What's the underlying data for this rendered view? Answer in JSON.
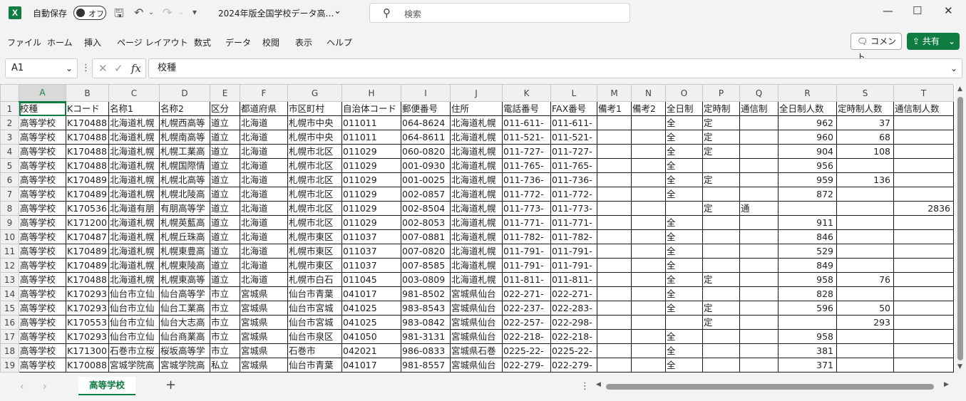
{
  "titlebar": {
    "autosave_label": "自動保存",
    "autosave_state": "オフ",
    "doc_title": "2024年版全国学校データ高…",
    "search_placeholder": "検索"
  },
  "menu": [
    "ファイル",
    "ホーム",
    "挿入",
    "ページ レイアウト",
    "数式",
    "データ",
    "校閲",
    "表示",
    "ヘルプ"
  ],
  "ribbon_buttons": {
    "comment": "コメント",
    "share": "共有"
  },
  "formula_bar": {
    "cell_ref": "A1",
    "value": "校種",
    "fx": "fx"
  },
  "columns": [
    "A",
    "B",
    "C",
    "D",
    "E",
    "F",
    "G",
    "H",
    "I",
    "J",
    "K",
    "L",
    "M",
    "N",
    "O",
    "P",
    "Q",
    "R",
    "S",
    "T"
  ],
  "header_row": [
    "校種",
    "Kコード",
    "名称1",
    "名称2",
    "区分",
    "都道府県",
    "市区町村",
    "自治体コード",
    "郵便番号",
    "住所",
    "電話番号",
    "FAX番号",
    "備考1",
    "備考2",
    "全日制",
    "定時制",
    "通信制",
    "全日制人数",
    "定時制人数",
    "通信制人数"
  ],
  "rows": [
    [
      "高等学校",
      "K170488",
      "北海道札幌",
      "札幌西高等",
      "道立",
      "北海道",
      "札幌市中央",
      "011011",
      "064-8624",
      "北海道札幌",
      "011-611-",
      "011-611-",
      "",
      "",
      "全",
      "定",
      "",
      "962",
      "37",
      ""
    ],
    [
      "高等学校",
      "K170488",
      "北海道札幌",
      "札幌南高等",
      "道立",
      "北海道",
      "札幌市中央",
      "011011",
      "064-8611",
      "北海道札幌",
      "011-521-",
      "011-521-",
      "",
      "",
      "全",
      "定",
      "",
      "960",
      "68",
      ""
    ],
    [
      "高等学校",
      "K170488",
      "北海道札幌",
      "札幌工業高",
      "道立",
      "北海道",
      "札幌市北区",
      "011029",
      "060-0820",
      "北海道札幌",
      "011-727-",
      "011-727-",
      "",
      "",
      "全",
      "定",
      "",
      "904",
      "108",
      ""
    ],
    [
      "高等学校",
      "K170488",
      "北海道札幌",
      "札幌国際情",
      "道立",
      "北海道",
      "札幌市北区",
      "011029",
      "001-0930",
      "北海道札幌",
      "011-765-",
      "011-765-",
      "",
      "",
      "全",
      "",
      "",
      "956",
      "",
      ""
    ],
    [
      "高等学校",
      "K170489",
      "北海道札幌",
      "札幌北高等",
      "道立",
      "北海道",
      "札幌市北区",
      "011029",
      "001-0025",
      "北海道札幌",
      "011-736-",
      "011-736-",
      "",
      "",
      "全",
      "定",
      "",
      "959",
      "136",
      ""
    ],
    [
      "高等学校",
      "K170489",
      "北海道札幌",
      "札幌北陵高",
      "道立",
      "北海道",
      "札幌市北区",
      "011029",
      "002-0857",
      "北海道札幌",
      "011-772-",
      "011-772-",
      "",
      "",
      "全",
      "",
      "",
      "872",
      "",
      ""
    ],
    [
      "高等学校",
      "K170536",
      "北海道有朋",
      "有朋高等学",
      "道立",
      "北海道",
      "札幌市北区",
      "011029",
      "002-8504",
      "北海道札幌",
      "011-773-",
      "011-773-",
      "",
      "",
      "",
      "定",
      "通",
      "",
      "",
      "2836"
    ],
    [
      "高等学校",
      "K171200",
      "北海道札幌",
      "札幌英藍高",
      "道立",
      "北海道",
      "札幌市北区",
      "011029",
      "002-8053",
      "北海道札幌",
      "011-771-",
      "011-771-",
      "",
      "",
      "全",
      "",
      "",
      "911",
      "",
      ""
    ],
    [
      "高等学校",
      "K170487",
      "北海道札幌",
      "札幌丘珠高",
      "道立",
      "北海道",
      "札幌市東区",
      "011037",
      "007-0881",
      "北海道札幌",
      "011-782-",
      "011-782-",
      "",
      "",
      "全",
      "",
      "",
      "846",
      "",
      ""
    ],
    [
      "高等学校",
      "K170489",
      "北海道札幌",
      "札幌東豊高",
      "道立",
      "北海道",
      "札幌市東区",
      "011037",
      "007-0820",
      "北海道札幌",
      "011-791-",
      "011-791-",
      "",
      "",
      "全",
      "",
      "",
      "529",
      "",
      ""
    ],
    [
      "高等学校",
      "K170489",
      "北海道札幌",
      "札幌東陵高",
      "道立",
      "北海道",
      "札幌市東区",
      "011037",
      "007-8585",
      "北海道札幌",
      "011-791-",
      "011-791-",
      "",
      "",
      "全",
      "",
      "",
      "849",
      "",
      ""
    ],
    [
      "高等学校",
      "K170488",
      "北海道札幌",
      "札幌東高等",
      "道立",
      "北海道",
      "札幌市白石",
      "011045",
      "003-0809",
      "北海道札幌",
      "011-811-",
      "011-811-",
      "",
      "",
      "全",
      "定",
      "",
      "958",
      "76",
      ""
    ],
    [
      "高等学校",
      "K170293",
      "仙台市立仙",
      "仙台高等学",
      "市立",
      "宮城県",
      "仙台市青葉",
      "041017",
      "981-8502",
      "宮城県仙台",
      "022-271-",
      "022-271-",
      "",
      "",
      "全",
      "",
      "",
      "828",
      "",
      ""
    ],
    [
      "高等学校",
      "K170293",
      "仙台市立仙",
      "仙台工業高",
      "市立",
      "宮城県",
      "仙台市宮城",
      "041025",
      "983-8543",
      "宮城県仙台",
      "022-237-",
      "022-283-",
      "",
      "",
      "全",
      "定",
      "",
      "596",
      "50",
      ""
    ],
    [
      "高等学校",
      "K170553",
      "仙台市立仙",
      "仙台大志高",
      "市立",
      "宮城県",
      "仙台市宮城",
      "041025",
      "983-0842",
      "宮城県仙台",
      "022-257-",
      "022-298-",
      "",
      "",
      "",
      "定",
      "",
      "",
      "293",
      ""
    ],
    [
      "高等学校",
      "K170293",
      "仙台市立仙",
      "仙台商業高",
      "市立",
      "宮城県",
      "仙台市泉区",
      "041050",
      "981-3131",
      "宮城県仙台",
      "022-218-",
      "022-218-",
      "",
      "",
      "全",
      "",
      "",
      "958",
      "",
      ""
    ],
    [
      "高等学校",
      "K171300",
      "石巻市立桜",
      "桜坂高等学",
      "市立",
      "宮城県",
      "石巻市",
      "042021",
      "986-0833",
      "宮城県石巻",
      "0225-22-",
      "0225-22-",
      "",
      "",
      "全",
      "",
      "",
      "381",
      "",
      ""
    ],
    [
      "高等学校",
      "K170088",
      "宮城学院高",
      "宮城学院高",
      "私立",
      "宮城県",
      "仙台市青葉",
      "041017",
      "981-8557",
      "宮城県仙台",
      "022-279-",
      "022-279-",
      "",
      "",
      "全",
      "",
      "",
      "371",
      "",
      ""
    ]
  ],
  "sheet_tab": "高等学校"
}
